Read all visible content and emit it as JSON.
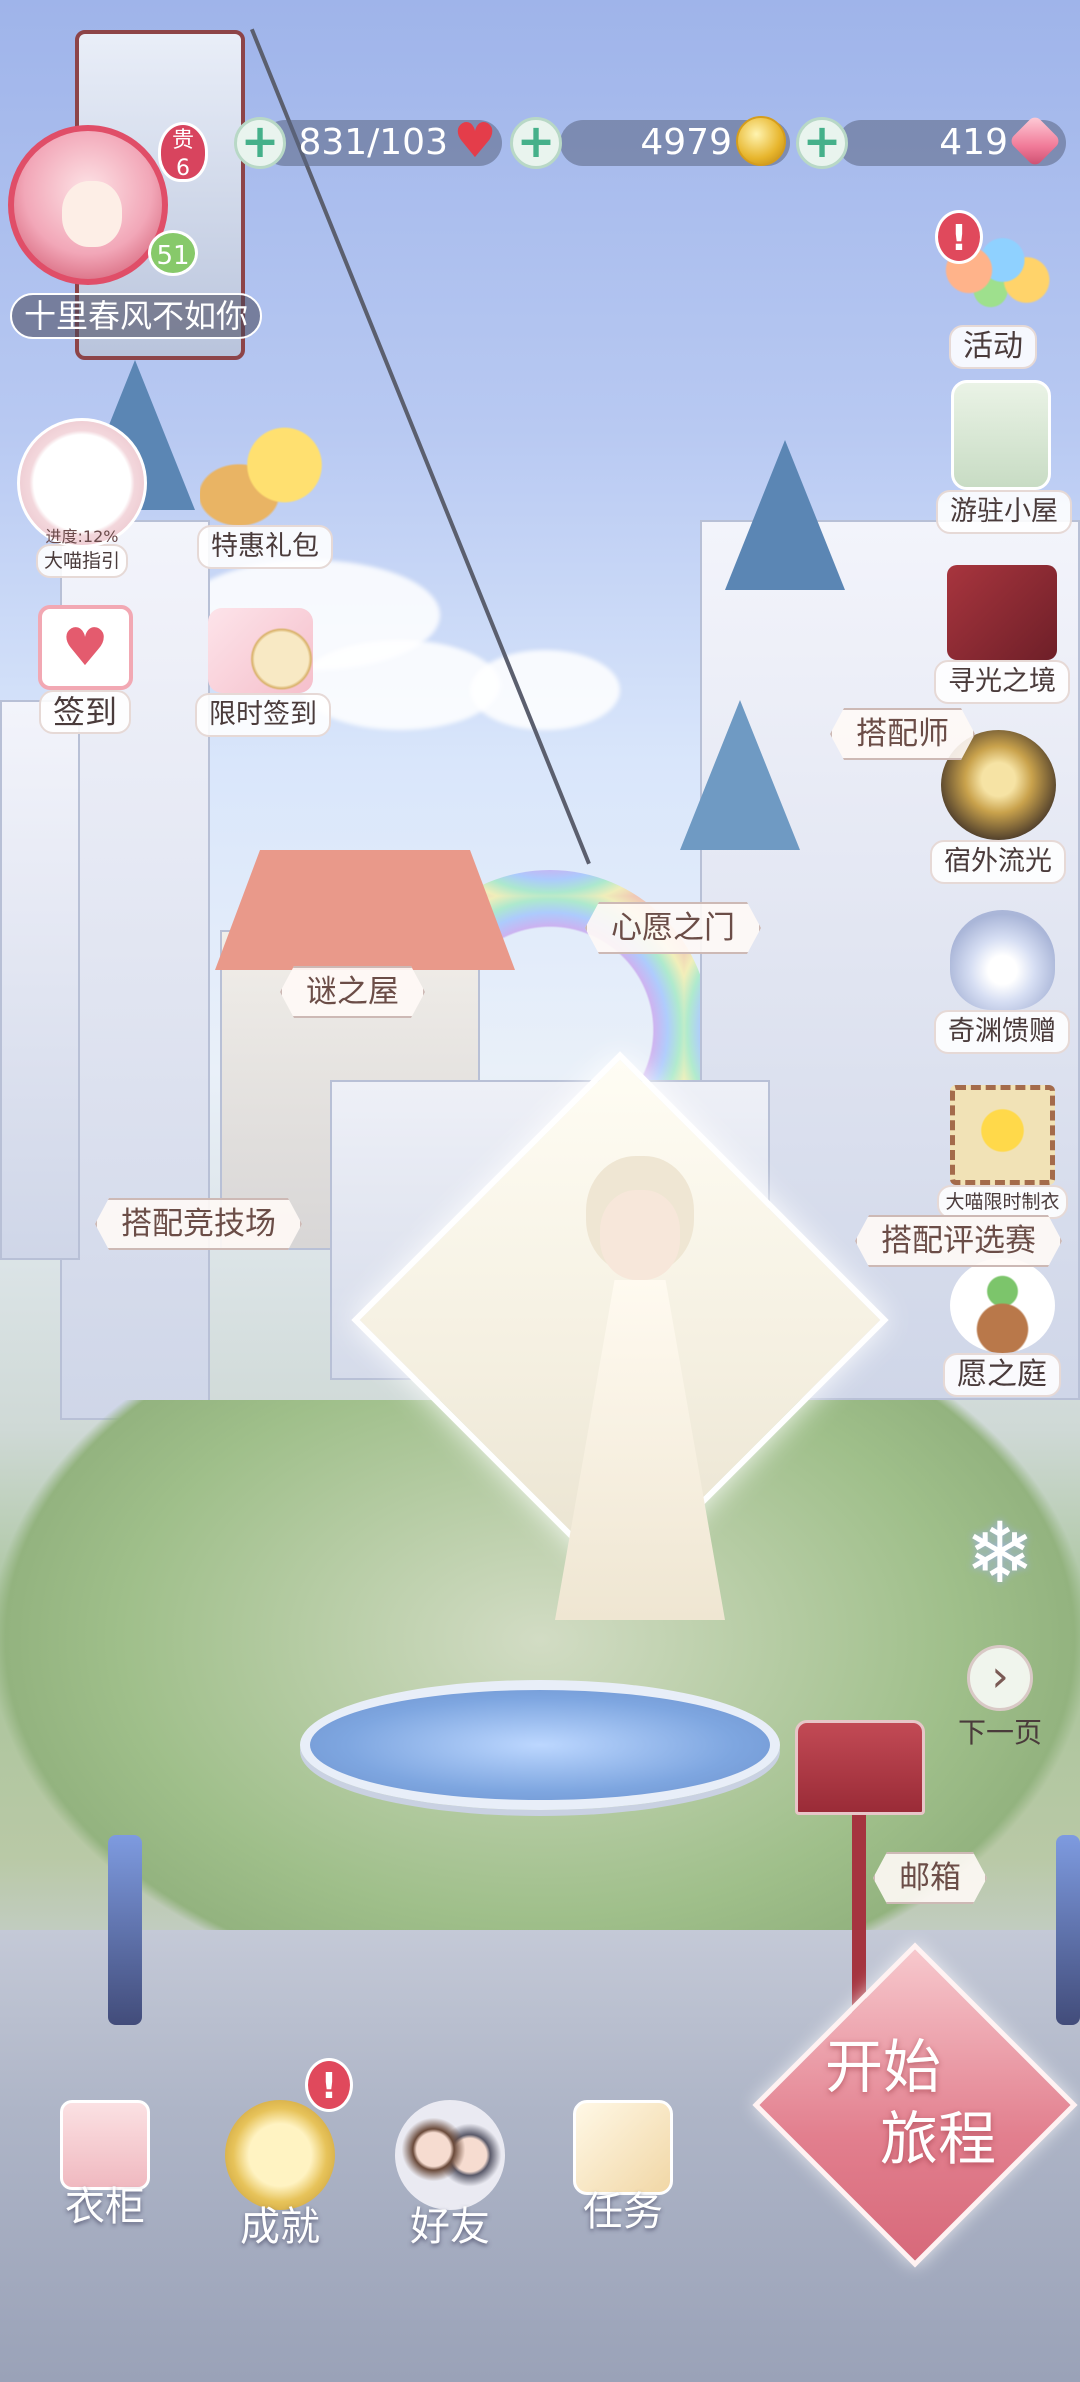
{
  "player": {
    "name": "十里春风不如你",
    "vip_label": "贵",
    "vip_level": "6",
    "level": "51"
  },
  "resources": [
    {
      "name": "stamina",
      "value": "831/103",
      "icon": "heart-icon",
      "color": "#e43d4a"
    },
    {
      "name": "gold",
      "value": "4979",
      "icon": "coin-icon",
      "color": "#e7b52c"
    },
    {
      "name": "diamond",
      "value": "419",
      "icon": "gem-icon",
      "color": "#f17a98"
    }
  ],
  "left_menu": {
    "guide": {
      "label": "大喵指引",
      "progress_label": "进度:12%",
      "progress": 0.12
    },
    "special_pack": {
      "label": "特惠礼包"
    },
    "sign_in": {
      "label": "签到"
    },
    "limited_sign_in": {
      "label": "限时签到"
    }
  },
  "right_menu": [
    {
      "label": "活动",
      "icon": "balloons-icon",
      "alert": "!"
    },
    {
      "label": "游驻小屋",
      "icon": "cottage-icon"
    },
    {
      "label": "寻光之境",
      "icon": "lightquest-icon"
    },
    {
      "label": "宿外流光",
      "icon": "lantern-icon"
    },
    {
      "label": "奇渊馈赠",
      "icon": "shell-icon"
    },
    {
      "label": "大喵限时制衣",
      "icon": "momo-stamp-icon"
    },
    {
      "label": "愿之庭",
      "icon": "sprout-icon"
    },
    {
      "label": "下一页",
      "icon": "next-page-icon"
    }
  ],
  "scene_signs": {
    "mystery_house": "谜之屋",
    "wish_gate": "心愿之门",
    "arena": "搭配竞技场",
    "judge_left": "搭配评选赛",
    "judge_top": "搭配师"
  },
  "mailbox": {
    "label": "邮箱"
  },
  "start": {
    "line1": "开始",
    "line2": "旅程"
  },
  "bottom_nav": [
    {
      "label": "衣柜",
      "icon": "wardrobe-icon"
    },
    {
      "label": "成就",
      "icon": "achievement-medal-icon",
      "alert": "!"
    },
    {
      "label": "好友",
      "icon": "friends-icon"
    },
    {
      "label": "任务",
      "icon": "tasks-icon"
    }
  ]
}
